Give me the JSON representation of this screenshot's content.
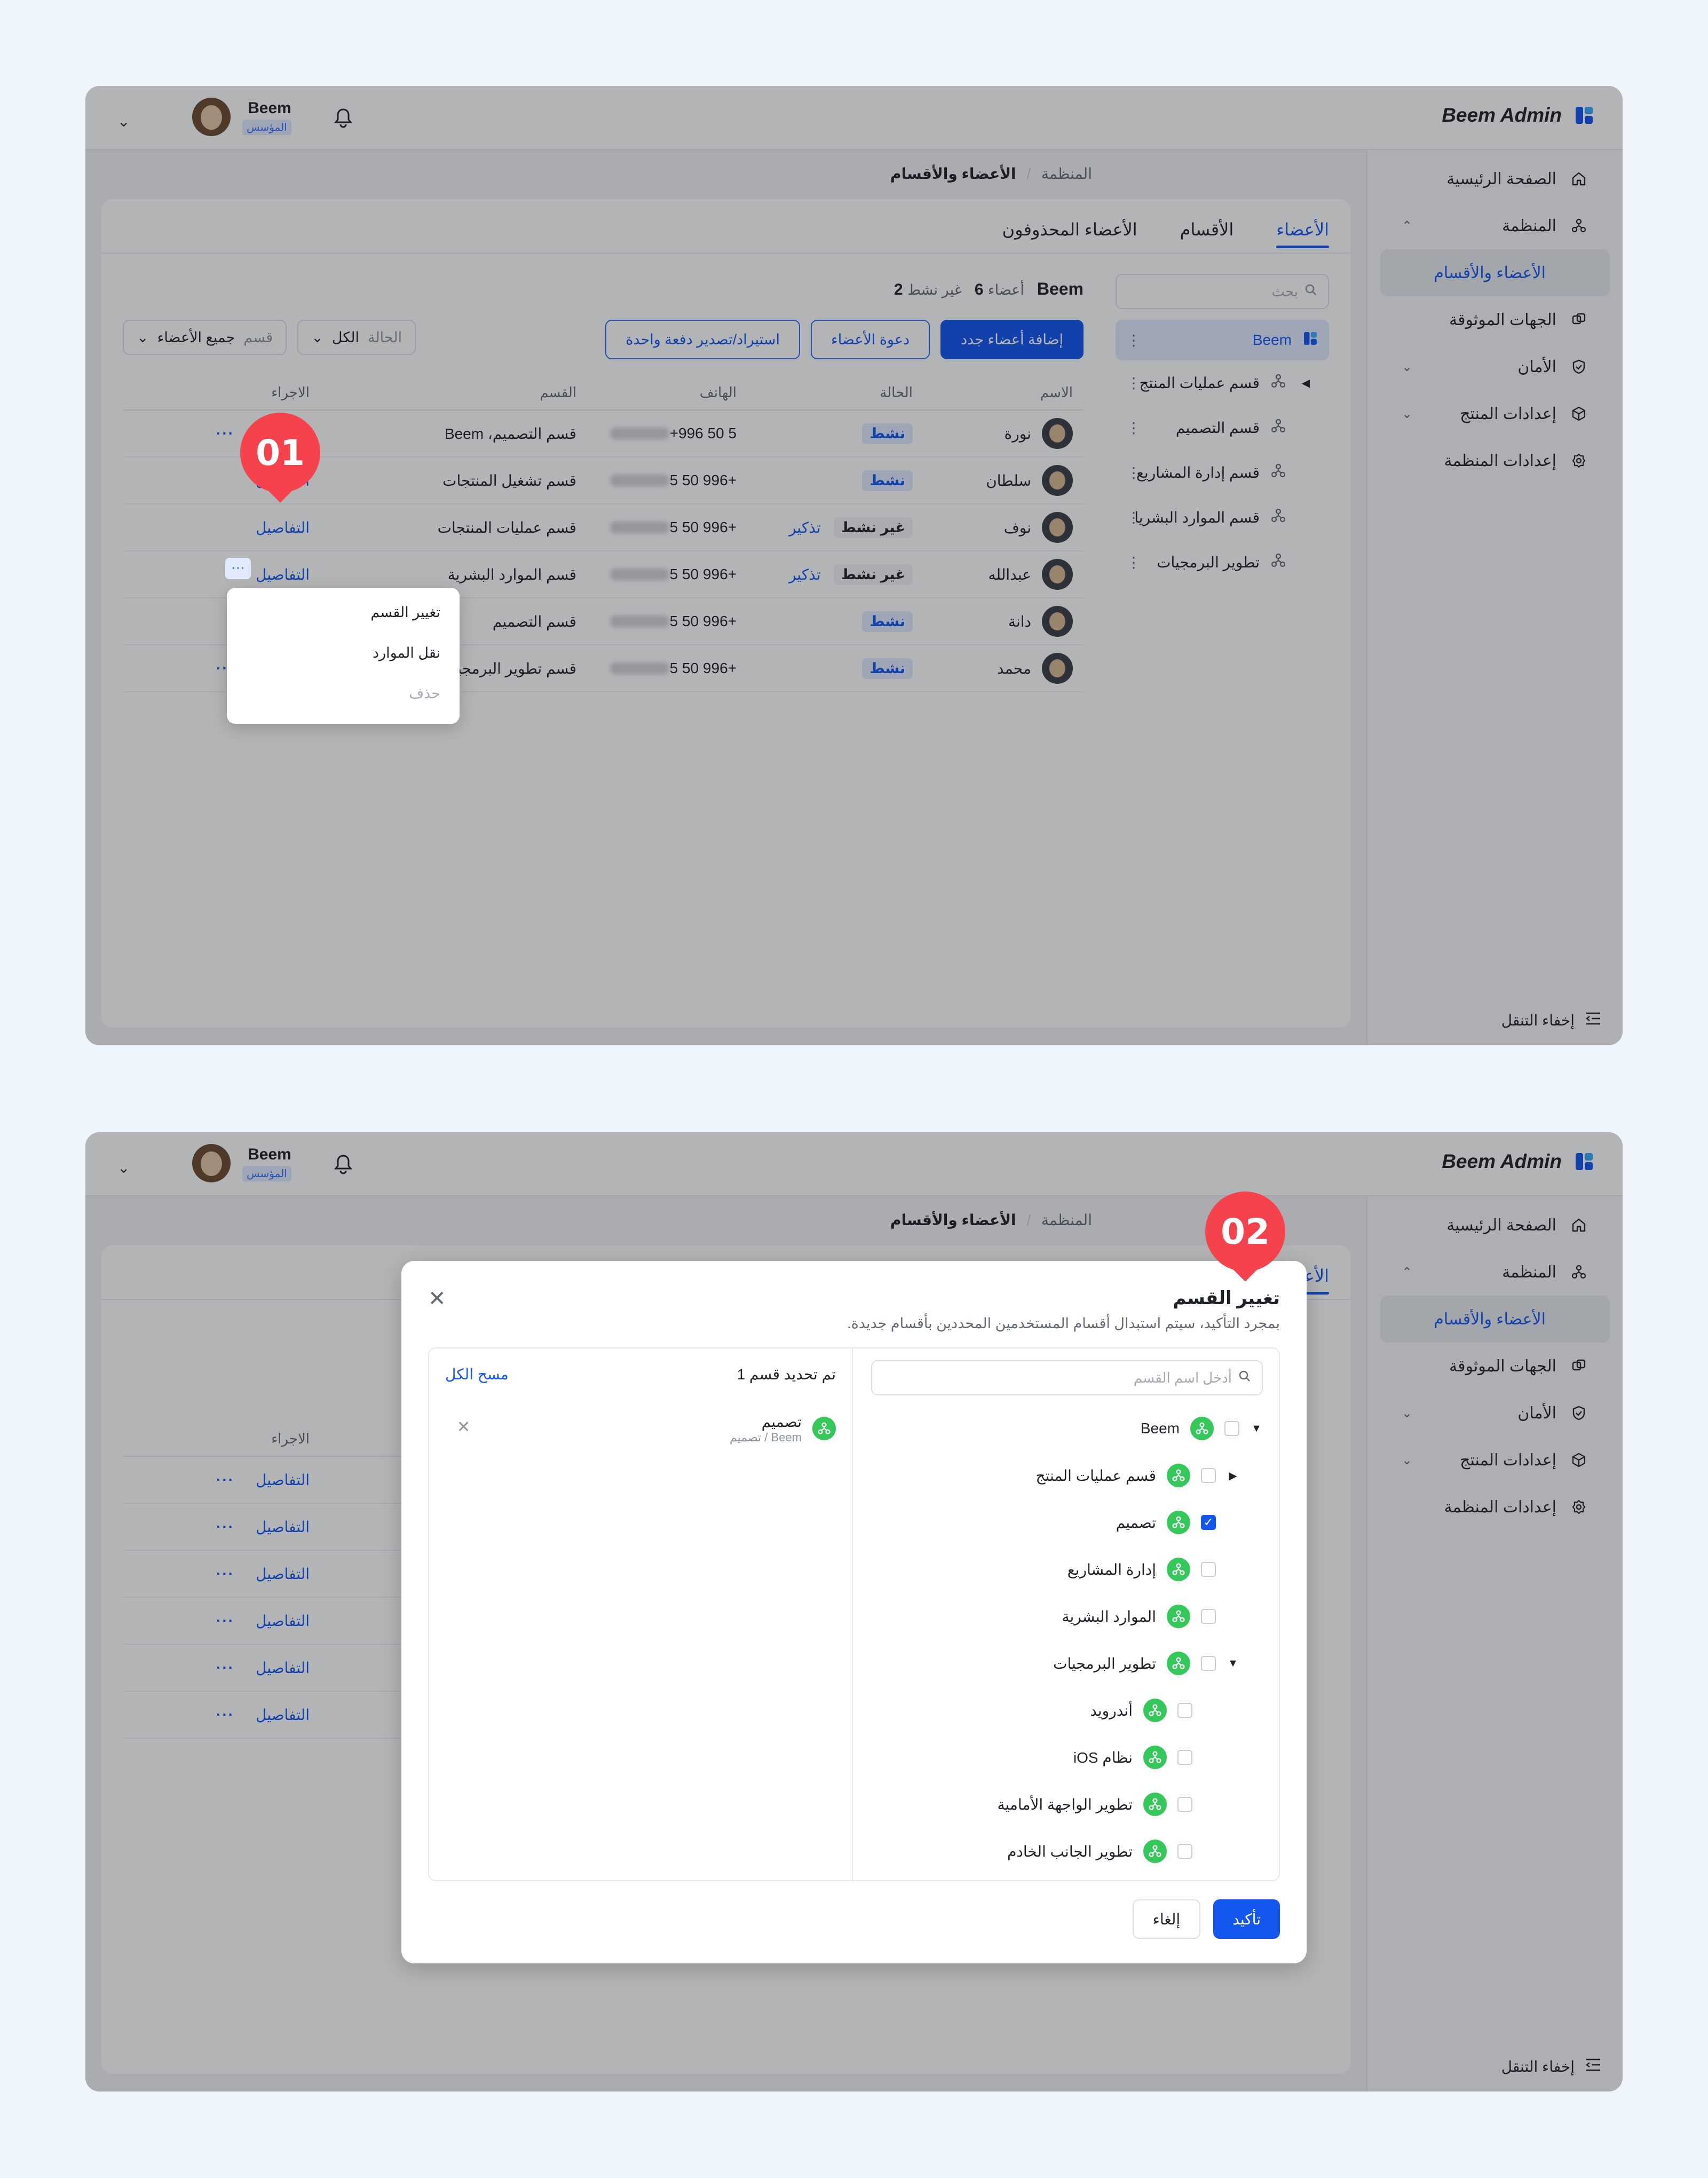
{
  "brand": {
    "title": "Beem Admin"
  },
  "user": {
    "name": "Beem",
    "role": "المؤسس"
  },
  "sidebar": {
    "items": [
      {
        "label": "الصفحة الرئيسية",
        "icon": "home-icon"
      },
      {
        "label": "المنظمة",
        "icon": "org-icon"
      },
      {
        "label": "الأعضاء والأقسام",
        "icon": ""
      },
      {
        "label": "الجهات الموثوقة",
        "icon": "link-icon"
      },
      {
        "label": "الأمان",
        "icon": "shield-icon"
      },
      {
        "label": "إعدادات المنتج",
        "icon": "cube-icon"
      },
      {
        "label": "إعدادات المنظمة",
        "icon": "gear-icon"
      }
    ],
    "footer": "إخفاء التنقل"
  },
  "breadcrumb": {
    "root": "المنظمة",
    "current": "الأعضاء والأقسام"
  },
  "tabs": [
    "الأعضاء",
    "الأقسام",
    "الأعضاء المحذوفون"
  ],
  "tree": {
    "search_placeholder": "بحث",
    "items": [
      "Beem",
      "قسم عمليات المنتج",
      "قسم التصميم",
      "قسم إدارة المشاريع",
      "قسم الموارد البشريا",
      "تطوير البرمجيات"
    ]
  },
  "summary": {
    "org": "Beem",
    "members_label": "أعضاء",
    "members": "6",
    "inactive_label": "غير نشط",
    "inactive": "2"
  },
  "buttons": {
    "add": "إضافة أعضاء جدد",
    "invite": "دعوة الأعضاء",
    "import": "استيراد/تصدير دفعة واحدة"
  },
  "filters": {
    "dept_label": "قسم",
    "dept_value": "جميع الأعضاء",
    "status_label": "الحالة",
    "status_value": "الكل"
  },
  "table": {
    "headers": {
      "name": "الاسم",
      "status": "الحالة",
      "phone": "الهاتف",
      "dept": "القسم",
      "actions": "الاجراء"
    },
    "rows": [
      {
        "name": "نورة",
        "status": "نشط",
        "remind": "",
        "phone": "+996 50 5",
        "dept": "قسم التصميم، Beem",
        "action": "التفاصيل"
      },
      {
        "name": "سلطان",
        "status": "نشط",
        "remind": "",
        "phone": "+996 50 5",
        "dept": "قسم تشغيل المنتجات",
        "action": "التفاصيل"
      },
      {
        "name": "نوف",
        "status": "غير نشط",
        "remind": "تذكير",
        "phone": "+996 50 5",
        "dept": "قسم عمليات المنتجات",
        "action": "التفاصيل"
      },
      {
        "name": "عبدالله",
        "status": "غير نشط",
        "remind": "تذكير",
        "phone": "+996 50 5",
        "dept": "قسم الموارد البشرية",
        "action": "التفاصيل"
      },
      {
        "name": "دانة",
        "status": "نشط",
        "remind": "",
        "phone": "+996 50 5",
        "dept": "قسم التصميم",
        "action": "التفاصيل"
      },
      {
        "name": "محمد",
        "status": "نشط",
        "remind": "",
        "phone": "+996 50 5",
        "dept": "قسم تطوير البرمجيات",
        "action": "التفاصيل"
      }
    ],
    "more": "···"
  },
  "context_menu": [
    "تغيير القسم",
    "نقل الموارد",
    "حذف"
  ],
  "steps": [
    "01",
    "02"
  ],
  "modal": {
    "title": "تغيير القسم",
    "subtitle": "بمجرد التأكيد، سيتم استبدال أقسام المستخدمين المحددين بأقسام جديدة.",
    "search_placeholder": "أدخل اسم القسم",
    "options": [
      {
        "label": "Beem",
        "checked": false,
        "expanded": true
      },
      {
        "label": "قسم عمليات المنتج",
        "checked": false
      },
      {
        "label": "تصميم",
        "checked": true
      },
      {
        "label": "إدارة المشاريع",
        "checked": false
      },
      {
        "label": "الموارد البشرية",
        "checked": false
      },
      {
        "label": "تطوير البرمجيات",
        "checked": false,
        "expanded": true
      },
      {
        "label": "أندرويد",
        "checked": false
      },
      {
        "label": "نظام iOS",
        "checked": false
      },
      {
        "label": "تطوير الواجهة الأمامية",
        "checked": false
      },
      {
        "label": "تطوير الجانب الخادم",
        "checked": false
      }
    ],
    "selected_header": "تم تحديد قسم 1",
    "clear_all": "مسح الكل",
    "selected_item": {
      "name": "تصميم",
      "path": "Beem / تصميم"
    },
    "cancel": "إلغاء",
    "confirm": "تأكيد"
  },
  "colors": {
    "primary": "#1456f0",
    "accent_red": "#f5424c",
    "group_green": "#34c759"
  }
}
